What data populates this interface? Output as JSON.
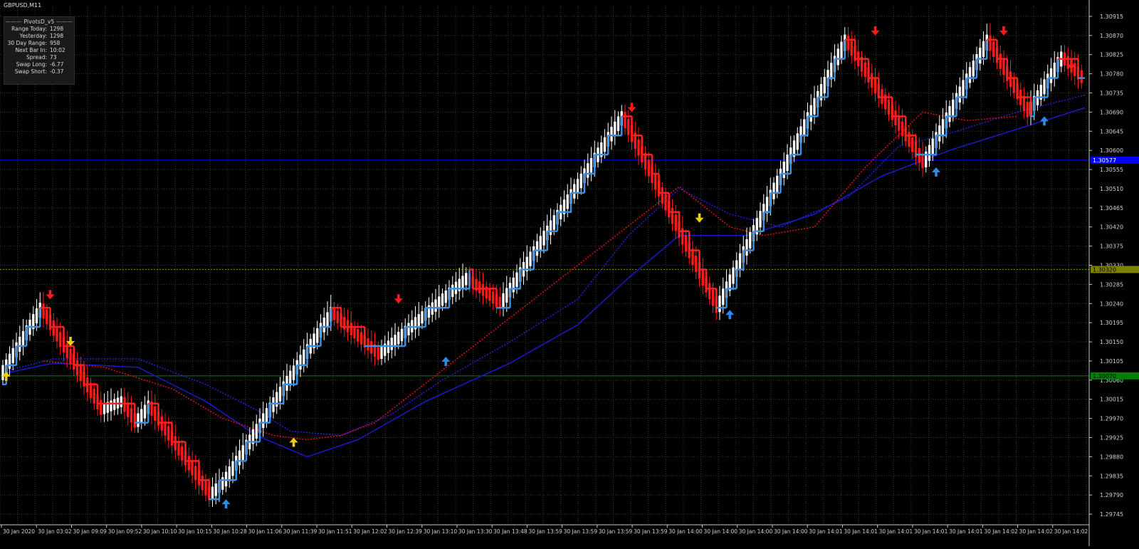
{
  "window": {
    "symbol_title": "GBPUSD,M11"
  },
  "info_panel": {
    "title": "PivotsD_v5",
    "rows": [
      {
        "label": "Range Today:",
        "value": "1298"
      },
      {
        "label": "Yesterday:",
        "value": "1298"
      },
      {
        "label": "30 Day Range:",
        "value": "958"
      },
      {
        "label": "Next Bar In:",
        "value": "10:02"
      },
      {
        "label": "Spread:",
        "value": "73"
      },
      {
        "label": "Swap Long:",
        "value": "-6.77"
      },
      {
        "label": "Swap Short:",
        "value": "-0.37"
      }
    ]
  },
  "colors": {
    "background": "#000000",
    "grid": "#2e3e2e",
    "bull_candle": "#ffffff",
    "bear_candle": "#ff1a1a",
    "renko_line_up": "#3a8fe0",
    "renko_line_down": "#ff2020",
    "ma_slow": "#1a1acc",
    "ma_fast": "#2222dd",
    "ma_red": "#e01010",
    "buy_arrow": "#2a8be8",
    "sell_arrow": "#ff1a1a",
    "yellow_arrow": "#e8d000",
    "level_blue": "#0000ff",
    "level_green": "#008000",
    "level_olive": "#808000"
  },
  "chart_data": {
    "type": "line",
    "title": "GBPUSD,M11",
    "y_axis": {
      "ylim": [
        1.2972,
        1.3094
      ],
      "ticks": [
        "1.30915",
        "1.30870",
        "1.30825",
        "1.30780",
        "1.30735",
        "1.30690",
        "1.30645",
        "1.30600",
        "1.30555",
        "1.30510",
        "1.30465",
        "1.30420",
        "1.30375",
        "1.30330",
        "1.30285",
        "1.30240",
        "1.30195",
        "1.30150",
        "1.30105",
        "1.30060",
        "1.30015",
        "1.29970",
        "1.29925",
        "1.29880",
        "1.29835",
        "1.29790",
        "1.29745"
      ]
    },
    "x_axis": {
      "ticks": [
        "30 Jan 2020",
        "30 Jan 03:02",
        "30 Jan 09:09",
        "30 Jan 09:52",
        "30 Jan 10:10",
        "30 Jan 10:15",
        "30 Jan 10:28",
        "30 Jan 11:06",
        "30 Jan 11:39",
        "30 Jan 11:51",
        "30 Jan 12:02",
        "30 Jan 12:39",
        "30 Jan 13:10",
        "30 Jan 13:30",
        "30 Jan 13:48",
        "30 Jan 13:59",
        "30 Jan 13:59",
        "30 Jan 13:59",
        "30 Jan 13:59",
        "30 Jan 14:00",
        "30 Jan 14:00",
        "30 Jan 14:00",
        "30 Jan 14:00",
        "30 Jan 14:01",
        "30 Jan 14:01",
        "30 Jan 14:01",
        "30 Jan 14:01",
        "30 Jan 14:01",
        "30 Jan 14:02",
        "30 Jan 14:02",
        "30 Jan 14:02"
      ]
    },
    "price_path": [
      {
        "bar": 0,
        "price": 1.3007
      },
      {
        "bar": 12,
        "price": 1.3023
      },
      {
        "bar": 30,
        "price": 1.2999
      },
      {
        "bar": 36,
        "price": 1.3001
      },
      {
        "bar": 40,
        "price": 1.2996
      },
      {
        "bar": 44,
        "price": 1.3
      },
      {
        "bar": 62,
        "price": 1.2979
      },
      {
        "bar": 66,
        "price": 1.2982
      },
      {
        "bar": 98,
        "price": 1.3022
      },
      {
        "bar": 112,
        "price": 1.3012
      },
      {
        "bar": 138,
        "price": 1.303
      },
      {
        "bar": 148,
        "price": 1.3024
      },
      {
        "bar": 184,
        "price": 1.3068
      },
      {
        "bar": 212,
        "price": 1.3023
      },
      {
        "bar": 250,
        "price": 1.3086
      },
      {
        "bar": 273,
        "price": 1.3057
      },
      {
        "bar": 292,
        "price": 1.3086
      },
      {
        "bar": 304,
        "price": 1.3069
      },
      {
        "bar": 314,
        "price": 1.3082
      },
      {
        "bar": 320,
        "price": 1.3077
      }
    ],
    "series": [
      {
        "key": "ma_fast",
        "points": [
          [
            0,
            1.3008
          ],
          [
            15,
            1.3011
          ],
          [
            40,
            1.3011
          ],
          [
            60,
            1.3005
          ],
          [
            75,
            1.2999
          ],
          [
            85,
            1.2994
          ],
          [
            100,
            1.2993
          ],
          [
            115,
            1.2998
          ],
          [
            130,
            1.3006
          ],
          [
            150,
            1.3015
          ],
          [
            170,
            1.3025
          ],
          [
            185,
            1.304
          ],
          [
            200,
            1.3051
          ],
          [
            215,
            1.3045
          ],
          [
            230,
            1.3042
          ],
          [
            250,
            1.3049
          ],
          [
            265,
            1.3061
          ],
          [
            280,
            1.3064
          ],
          [
            300,
            1.3069
          ],
          [
            320,
            1.3073
          ]
        ]
      },
      {
        "key": "ma_slow",
        "points": [
          [
            0,
            1.30075
          ],
          [
            15,
            1.301
          ],
          [
            40,
            1.3009
          ],
          [
            60,
            1.3001
          ],
          [
            75,
            1.2993
          ],
          [
            90,
            1.2988
          ],
          [
            105,
            1.2992
          ],
          [
            125,
            1.3001
          ],
          [
            150,
            1.301
          ],
          [
            170,
            1.3019
          ],
          [
            185,
            1.303
          ],
          [
            200,
            1.304
          ],
          [
            220,
            1.304
          ],
          [
            240,
            1.3045
          ],
          [
            260,
            1.3054
          ],
          [
            280,
            1.306
          ],
          [
            300,
            1.3065
          ],
          [
            320,
            1.307
          ]
        ]
      },
      {
        "key": "ma_red",
        "points": [
          [
            12,
            1.30105
          ],
          [
            30,
            1.3009
          ],
          [
            50,
            1.3004
          ],
          [
            65,
            1.2997
          ],
          [
            80,
            1.2993
          ],
          [
            90,
            1.2992
          ],
          [
            100,
            1.2993
          ],
          [
            110,
            1.2996
          ],
          [
            200,
            1.30515
          ],
          [
            215,
            1.3042
          ],
          [
            225,
            1.304
          ],
          [
            240,
            1.3042
          ],
          [
            255,
            1.3056
          ],
          [
            272,
            1.3069
          ],
          [
            285,
            1.3067
          ],
          [
            300,
            1.3068
          ]
        ]
      }
    ],
    "levels": [
      {
        "name": "blue_level",
        "price": 1.30577,
        "label": "1.30577"
      },
      {
        "name": "olive_level",
        "price": 1.3032,
        "label": "1.30320"
      },
      {
        "name": "green_level",
        "price": 1.3007,
        "label": "1.30070"
      }
    ],
    "arrows": [
      {
        "type": "yellow-up",
        "bar": 1,
        "price": 1.3007
      },
      {
        "type": "sell",
        "bar": 14,
        "price": 1.3026
      },
      {
        "type": "yellow-down",
        "bar": 20,
        "price": 1.3015
      },
      {
        "type": "buy",
        "bar": 66,
        "price": 1.2977
      },
      {
        "type": "yellow-up",
        "bar": 86,
        "price": 1.29915
      },
      {
        "type": "sell",
        "bar": 117,
        "price": 1.3025
      },
      {
        "type": "buy",
        "bar": 131,
        "price": 1.30105
      },
      {
        "type": "sell",
        "bar": 186,
        "price": 1.307
      },
      {
        "type": "yellow-down",
        "bar": 206,
        "price": 1.3044
      },
      {
        "type": "buy",
        "bar": 215,
        "price": 1.30215
      },
      {
        "type": "sell",
        "bar": 258,
        "price": 1.3088
      },
      {
        "type": "buy",
        "bar": 276,
        "price": 1.3055
      },
      {
        "type": "sell",
        "bar": 296,
        "price": 1.3088
      },
      {
        "type": "buy",
        "bar": 308,
        "price": 1.3067
      },
      {
        "type": "sell",
        "bar": 316,
        "price": 1.308
      }
    ],
    "grid": true,
    "legend": "none"
  }
}
